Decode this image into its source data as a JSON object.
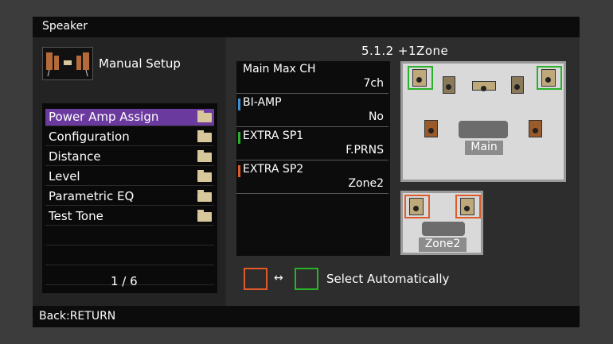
{
  "title": "Speaker",
  "header": {
    "label": "Manual Setup",
    "icon": "speaker-setup-icon"
  },
  "menu": {
    "items": [
      {
        "label": "Power Amp Assign",
        "selected": true
      },
      {
        "label": "Configuration"
      },
      {
        "label": "Distance"
      },
      {
        "label": "Level"
      },
      {
        "label": "Parametric EQ"
      },
      {
        "label": "Test Tone"
      }
    ],
    "page": "1 / 6"
  },
  "mode": "5.1.2 +1Zone",
  "settings": [
    {
      "key": "Main Max CH",
      "value": "7ch",
      "accent": ""
    },
    {
      "key": "BI-AMP",
      "value": "No",
      "accent": "#3a8fd6"
    },
    {
      "key": "EXTRA SP1",
      "value": "F.PRNS",
      "accent": "#2ab12a"
    },
    {
      "key": "EXTRA SP2",
      "value": "Zone2",
      "accent": "#e05a2a"
    }
  ],
  "diagram": {
    "main_label": "Main",
    "zone2_label": "Zone2"
  },
  "legend": {
    "arrow": "↔",
    "text": "Select Automatically"
  },
  "footer": "Back:RETURN",
  "colors": {
    "selected": "#6b3a9e",
    "red": "#e05a2a",
    "green": "#2ab12a",
    "blue": "#3a8fd6"
  }
}
